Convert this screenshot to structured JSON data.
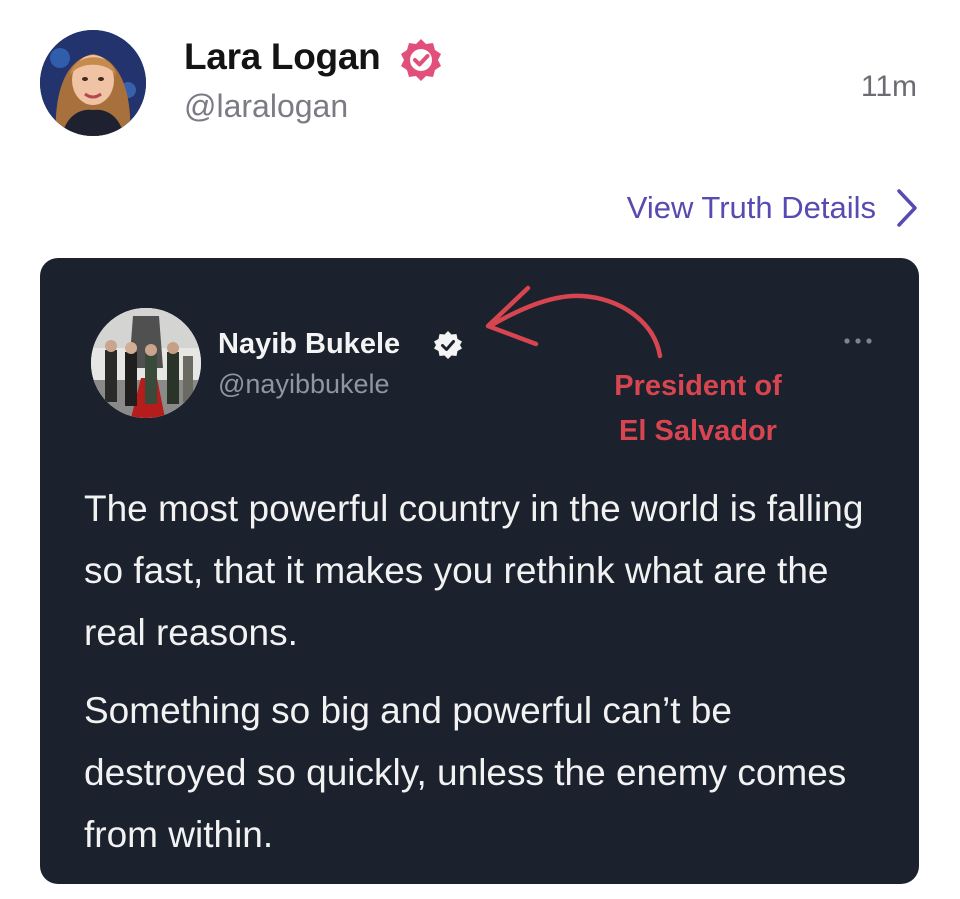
{
  "post": {
    "author_name": "Lara Logan",
    "author_handle": "@laralogan",
    "timestamp": "11m",
    "view_details_label": "View Truth Details"
  },
  "embed": {
    "author_name": "Nayib Bukele",
    "author_handle": "@nayibbukele",
    "annotation_line1": "President of",
    "annotation_line2": "El Salvador",
    "paragraphs": [
      "The most powerful country in the world is falling so fast, that it makes you rethink what are the real reasons.",
      "Something so big and powerful can’t be destroyed so quickly, unless the enemy comes from within."
    ]
  },
  "icons": {
    "verified_main": "verified-badge-icon",
    "verified_embed": "verified-badge-icon",
    "chevron": "chevron-right-icon",
    "more": "more-horizontal-icon"
  },
  "colors": {
    "accent": "#574ab0",
    "verified_badge": "#e0507a",
    "card_background": "#1b212d",
    "annotation": "#d64550"
  }
}
